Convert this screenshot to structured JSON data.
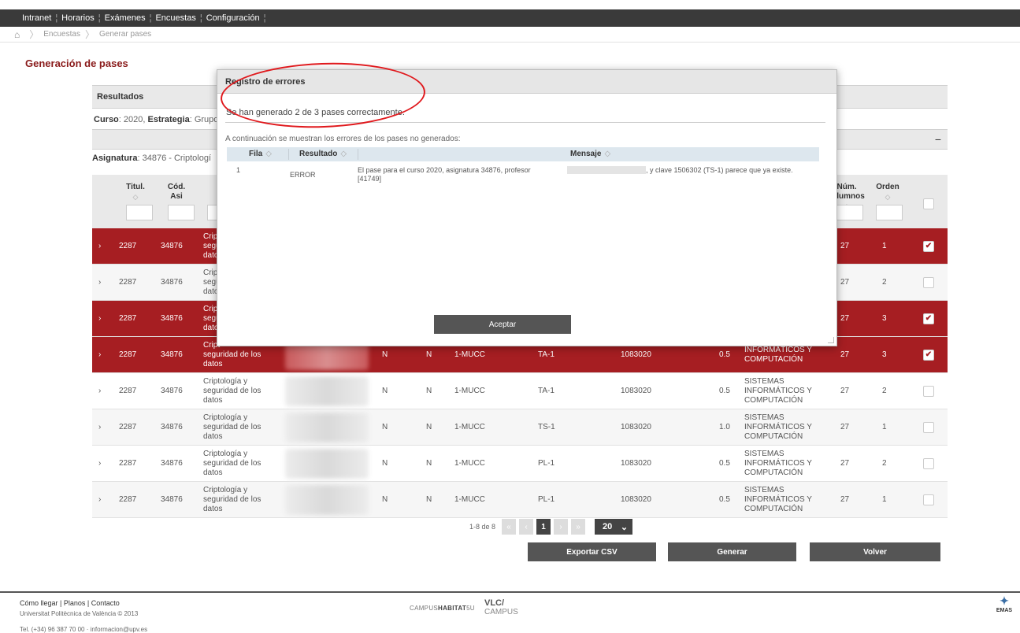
{
  "topnav": {
    "items": [
      "Intranet",
      "Horarios",
      "Exámenes",
      "Encuestas",
      "Configuración"
    ]
  },
  "breadcrumb": {
    "items": [
      "Encuestas",
      "Generar pases"
    ]
  },
  "page_title": "Generación de pases",
  "resultados": {
    "title": "Resultados",
    "curso_label": "Curso",
    "curso_value": "2020,",
    "estrategia_label": "Estrategia",
    "estrategia_value": "Grupo",
    "asignatura_label": "Asignatura",
    "asignatura_value": "34876 - Criptologí"
  },
  "table": {
    "headers": {
      "titul": "Titul.",
      "cod_asi": "Cód. Asi",
      "num_alumnos": "Núm. Alumnos",
      "orden": "Orden"
    },
    "rows": [
      {
        "titul": "2287",
        "cod": "34876",
        "asig": "Crip\nsegu\ndato",
        "n1": "",
        "n2": "",
        "grupo": "",
        "tipo": "",
        "clave": "",
        "cred": "",
        "depto": "",
        "alumnos": "27",
        "orden": "1",
        "checked": true,
        "selected": true
      },
      {
        "titul": "2287",
        "cod": "34876",
        "asig": "Crip\nsegu\ndato",
        "n1": "",
        "n2": "",
        "grupo": "",
        "tipo": "",
        "clave": "",
        "cred": "",
        "depto": "",
        "alumnos": "27",
        "orden": "2",
        "checked": false,
        "selected": false
      },
      {
        "titul": "2287",
        "cod": "34876",
        "asig": "Crip\nsegu\ndato",
        "n1": "",
        "n2": "",
        "grupo": "",
        "tipo": "",
        "clave": "",
        "cred": "",
        "depto": "",
        "alumnos": "27",
        "orden": "3",
        "checked": true,
        "selected": true
      },
      {
        "titul": "2287",
        "cod": "34876",
        "asig": "Cript\nseguridad de los\ndatos",
        "n1": "N",
        "n2": "N",
        "grupo": "1-MUCC",
        "tipo": "TA-1",
        "clave": "1083020",
        "cred": "0.5",
        "depto": "INFORMÁTICOS Y\nCOMPUTACIÓN",
        "alumnos": "27",
        "orden": "3",
        "checked": true,
        "selected": true
      },
      {
        "titul": "2287",
        "cod": "34876",
        "asig": "Criptología y\nseguridad de los\ndatos",
        "n1": "N",
        "n2": "N",
        "grupo": "1-MUCC",
        "tipo": "TA-1",
        "clave": "1083020",
        "cred": "0.5",
        "depto": "SISTEMAS\nINFORMÁTICOS Y\nCOMPUTACIÓN",
        "alumnos": "27",
        "orden": "2",
        "checked": false,
        "selected": false
      },
      {
        "titul": "2287",
        "cod": "34876",
        "asig": "Criptología y\nseguridad de los\ndatos",
        "n1": "N",
        "n2": "N",
        "grupo": "1-MUCC",
        "tipo": "TS-1",
        "clave": "1083020",
        "cred": "1.0",
        "depto": "SISTEMAS\nINFORMÁTICOS Y\nCOMPUTACIÓN",
        "alumnos": "27",
        "orden": "1",
        "checked": false,
        "selected": false
      },
      {
        "titul": "2287",
        "cod": "34876",
        "asig": "Criptología y\nseguridad de los\ndatos",
        "n1": "N",
        "n2": "N",
        "grupo": "1-MUCC",
        "tipo": "PL-1",
        "clave": "1083020",
        "cred": "0.5",
        "depto": "SISTEMAS\nINFORMÁTICOS Y\nCOMPUTACIÓN",
        "alumnos": "27",
        "orden": "2",
        "checked": false,
        "selected": false
      },
      {
        "titul": "2287",
        "cod": "34876",
        "asig": "Criptología y\nseguridad de los\ndatos",
        "n1": "N",
        "n2": "N",
        "grupo": "1-MUCC",
        "tipo": "PL-1",
        "clave": "1083020",
        "cred": "0.5",
        "depto": "SISTEMAS\nINFORMÁTICOS Y\nCOMPUTACIÓN",
        "alumnos": "27",
        "orden": "1",
        "checked": false,
        "selected": false
      }
    ]
  },
  "pager": {
    "info": "1-8 de 8",
    "current_page": "1",
    "page_size": "20"
  },
  "actions": {
    "export": "Exportar CSV",
    "generate": "Generar",
    "back": "Volver"
  },
  "modal": {
    "title": "Registro de errores",
    "message": "Se han generado 2 de 3 pases correctamente.",
    "intro": "A continuación se muestran los errores de los pases no generados:",
    "headers": {
      "fila": "Fila",
      "resultado": "Resultado",
      "mensaje": "Mensaje"
    },
    "rows": [
      {
        "fila": "1",
        "resultado": "ERROR",
        "mensaje_a": "El pase para el curso 2020, asignatura 34876, profesor",
        "mensaje_b": ", y clave 1506302 (TS-1) parece que ya existe.",
        "mensaje_c": "[41749]"
      }
    ],
    "ok": "Aceptar"
  },
  "footer": {
    "links": "Cómo llegar | Planos | Contacto",
    "copyright": "Universitat Politècnica de València © 2013",
    "contact": "Tel. (+34) 96 387 70 00 · informacion@upv.es",
    "logo1_a": "CAMPUS",
    "logo1_b": "HABITAT",
    "logo1_c": "5U",
    "logo2_a": "VLC/",
    "logo2_b": "CAMPUS",
    "emas": "EMAS"
  },
  "colors": {
    "selected_row": "#a61e22",
    "title": "#8a1b1b",
    "dark": "#3a3a3a"
  }
}
